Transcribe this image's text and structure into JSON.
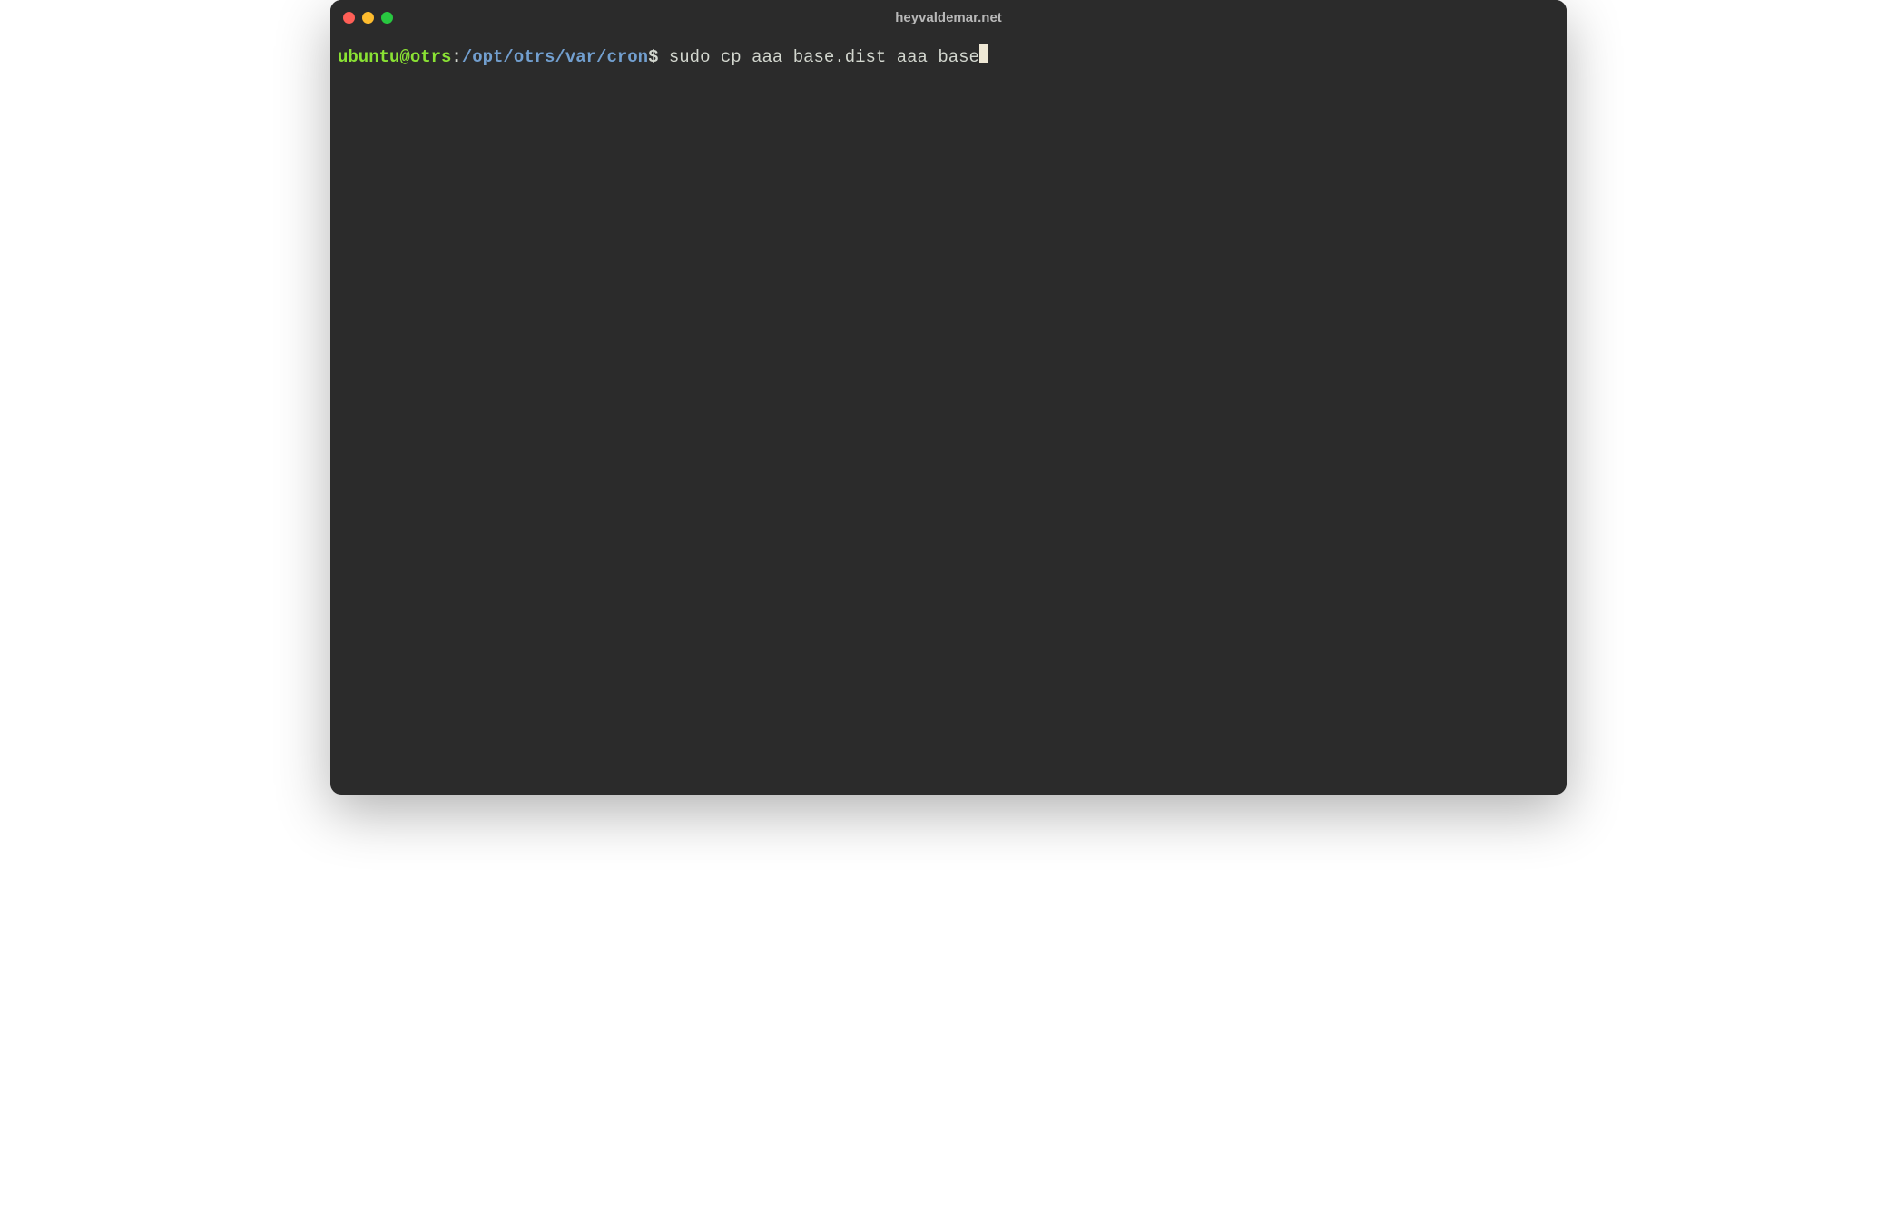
{
  "window": {
    "title": "heyvaldemar.net"
  },
  "traffic_lights": {
    "close_color": "#ff5f57",
    "minimize_color": "#febc2e",
    "maximize_color": "#28c840"
  },
  "prompt": {
    "user_host": "ubuntu@otrs",
    "separator": ":",
    "path": "/opt/otrs/var/cron",
    "symbol": "$"
  },
  "command": " sudo cp aaa_base.dist aaa_base",
  "colors": {
    "background": "#2b2b2b",
    "prompt_user": "#8ae234",
    "prompt_path": "#729fcf",
    "text": "#d3d7cf",
    "cursor": "#eee8d5"
  }
}
